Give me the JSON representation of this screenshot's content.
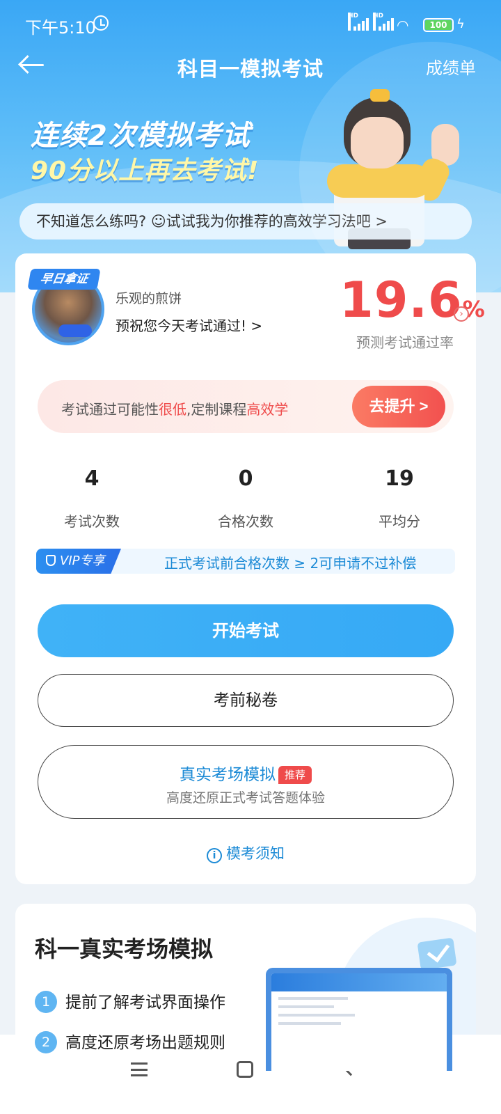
{
  "status_bar": {
    "time": "下午5:10",
    "signal_label": "HD",
    "battery": "100"
  },
  "nav": {
    "title": "科目一模拟考试",
    "right_link": "成绩单"
  },
  "hero": {
    "line1": "连续2次模拟考试",
    "line2": "90分以上再去考试!",
    "tip": "不知道怎么练吗? ☺试试我为你推荐的高效学习法吧 >"
  },
  "profile": {
    "badge_label": "早日拿证",
    "user_name": "乐观的煎饼",
    "wish": "预祝您今天考试通过! >",
    "pass_rate_value": "19.6",
    "pass_rate_unit": "%",
    "pass_rate_caption": "预测考试通过率"
  },
  "alert": {
    "prefix": "考试通过可能性",
    "level": "很低",
    "middle": ",定制课程",
    "course": "高效学",
    "button": "去提升 >"
  },
  "stats": [
    {
      "value": "4",
      "label": "考试次数"
    },
    {
      "value": "0",
      "label": "合格次数"
    },
    {
      "value": "19",
      "label": "平均分"
    }
  ],
  "vip": {
    "tag": "VIP专享",
    "text": "正式考试前合格次数 ≥ 2可申请不过补偿"
  },
  "buttons": {
    "start": "开始考试",
    "secret": "考前秘卷",
    "real_title": "真实考场模拟",
    "real_tag": "推荐",
    "real_subtitle": "高度还原正式考试答题体验",
    "notice": "模考须知"
  },
  "section": {
    "title": "科一真实考场模拟",
    "items": [
      {
        "num": "1",
        "text": "提前了解考试界面操作"
      },
      {
        "num": "2",
        "text": "高度还原考场出题规则"
      }
    ]
  },
  "colors": {
    "accent_blue": "#36a9f5",
    "alert_red": "#ef4b4b"
  }
}
